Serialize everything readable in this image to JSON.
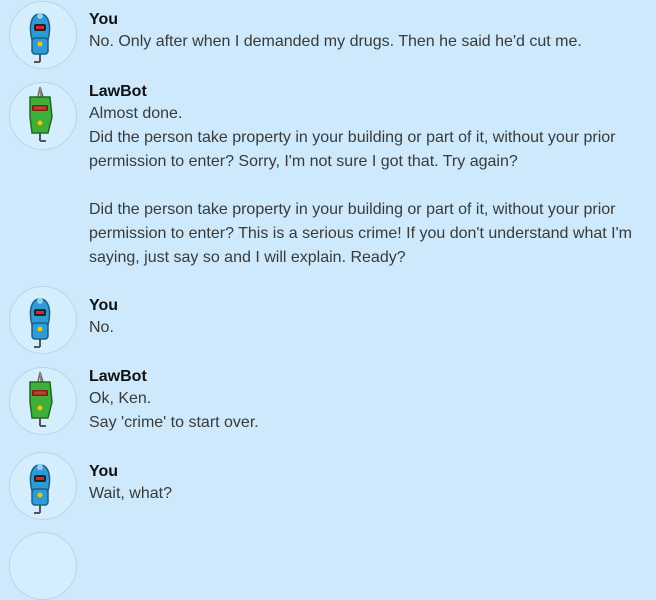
{
  "messages": [
    {
      "sender": "You",
      "avatar": "blue-robot-icon",
      "lines": [
        "No.  Only after when I demanded my drugs.  Then he said he'd cut me."
      ]
    },
    {
      "sender": "LawBot",
      "avatar": "green-robot-icon",
      "lines": [
        "Almost done.",
        "Did the person take property in your building or part of it, without your prior",
        "permission to enter? Sorry, I'm not sure I got that. Try again?",
        "",
        "Did the person take property in your building or part of it, without your prior",
        "permission to enter? This is a serious crime! If you don't understand what I'm",
        "saying, just say so and I will explain. Ready?"
      ]
    },
    {
      "sender": "You",
      "avatar": "blue-robot-icon",
      "lines": [
        "No."
      ]
    },
    {
      "sender": "LawBot",
      "avatar": "green-robot-icon",
      "lines": [
        "Ok, Ken.",
        "Say 'crime' to start over."
      ]
    },
    {
      "sender": "You",
      "avatar": "blue-robot-icon",
      "lines": [
        "Wait, what?"
      ]
    }
  ],
  "colors": {
    "background": "#cde9fb",
    "user_robot": "#2e9ad6",
    "bot_robot": "#3fae3a"
  }
}
